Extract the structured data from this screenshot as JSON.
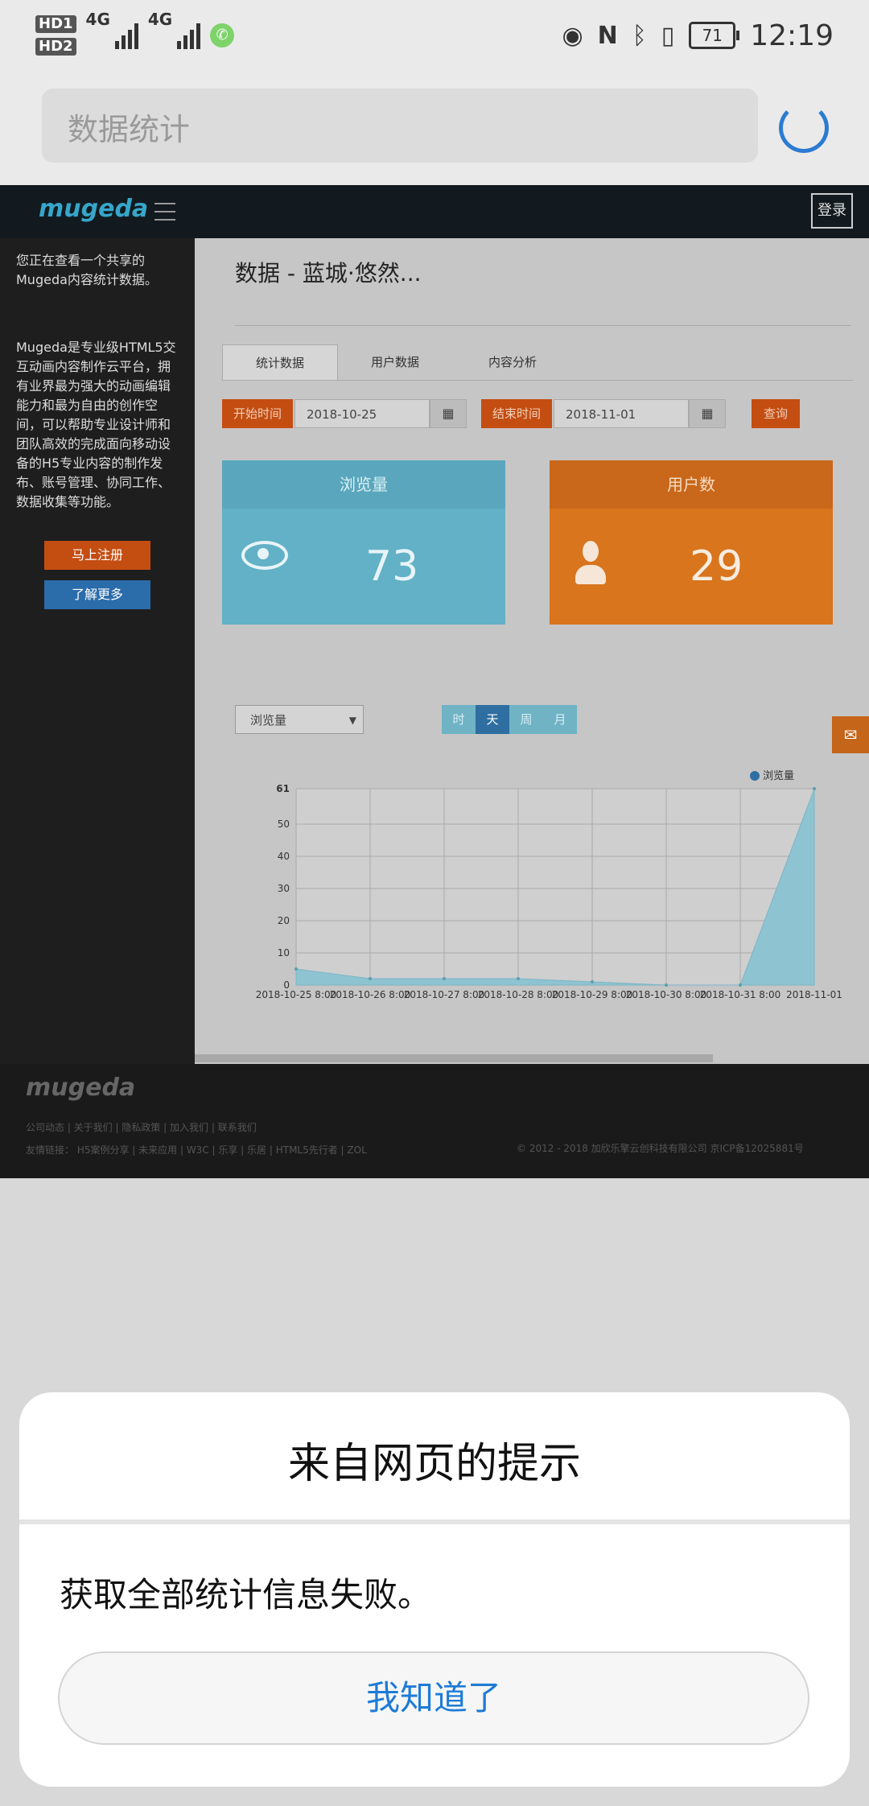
{
  "status_bar": {
    "sim1": "HD1",
    "sim2": "HD2",
    "network1": "4G",
    "network2": "4G",
    "battery": "71",
    "time": "12:19"
  },
  "browser": {
    "url_text": "数据统计"
  },
  "site": {
    "logo": "mugeda",
    "login_label": "登录"
  },
  "sidebar": {
    "intro": "您正在查看一个共享的Mugeda内容统计数据。",
    "description": "Mugeda是专业级HTML5交互动画内容制作云平台，拥有业界最为强大的动画编辑能力和最为自由的创作空间，可以帮助专业设计师和团队高效的完成面向移动设备的H5专业内容的制作发布、账号管理、协同工作、数据收集等功能。",
    "register_label": "马上注册",
    "learn_more_label": "了解更多"
  },
  "main": {
    "title": "数据 - 蓝城·悠然...",
    "tabs": [
      "统计数据",
      "用户数据",
      "内容分析"
    ],
    "start_label": "开始时间",
    "start_date": "2018-10-25",
    "end_label": "结束时间",
    "end_date": "2018-11-01",
    "query_label": "查询",
    "views_card": {
      "label": "浏览量",
      "value": "73"
    },
    "users_card": {
      "label": "用户数",
      "value": "29"
    },
    "metric_select": "浏览量",
    "granularity": [
      "时",
      "天",
      "周",
      "月"
    ],
    "selected_granularity": "天"
  },
  "chart_data": {
    "type": "area",
    "legend": "浏览量",
    "legend_position": "top-right",
    "categories": [
      "2018-10-25 8:00",
      "2018-10-26 8:00",
      "2018-10-27 8:00",
      "2018-10-28 8:00",
      "2018-10-29 8:00",
      "2018-10-30 8:00",
      "2018-10-31 8:00",
      "2018-11-01"
    ],
    "series": [
      {
        "name": "浏览量",
        "values": [
          5,
          2,
          2,
          2,
          1,
          0,
          0,
          61
        ]
      }
    ],
    "ylim": [
      0,
      61
    ],
    "yticks": [
      0,
      10,
      20,
      30,
      40,
      50,
      61
    ],
    "grid": true
  },
  "footer": {
    "logo": "mugeda",
    "links_row1": "公司动态 | 关于我们 | 隐私政策 | 加入我们 | 联系我们",
    "links_row2": "友情链接：   H5案例分享 | 未来应用 | W3C | 乐享 | 乐居 | HTML5先行者 | ZOL",
    "copyright": "© 2012 - 2018 加欣乐擎云创科技有限公司 京ICP备12025881号"
  },
  "dialog": {
    "title": "来自网页的提示",
    "message": "获取全部统计信息失败。",
    "button_label": "我知道了"
  },
  "colors": {
    "views_card_head": "#5aa7bd",
    "views_card_body": "#62b1c6",
    "users_card_head": "#c9671a",
    "users_card_body": "#d8751d",
    "accent_blue": "#1e7bd6",
    "chart_area": "#8ec3d2"
  }
}
